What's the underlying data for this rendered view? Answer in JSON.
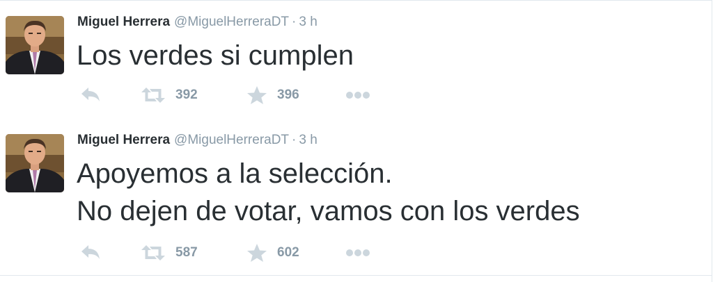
{
  "tweets": [
    {
      "fullname": "Miguel Herrera",
      "username": "@MiguelHerreraDT",
      "separator": "·",
      "time": "3 h",
      "text_lines": [
        "Los verdes si cumplen"
      ],
      "retweets": "392",
      "favorites": "396",
      "avatar_icon": "profile-photo-man-in-suit"
    },
    {
      "fullname": "Miguel Herrera",
      "username": "@MiguelHerreraDT",
      "separator": "·",
      "time": "3 h",
      "text_lines": [
        "Apoyemos a la selección.",
        "No dejen de votar, vamos con los verdes"
      ],
      "retweets": "587",
      "favorites": "602",
      "avatar_icon": "profile-photo-man-in-suit"
    }
  ],
  "icons": {
    "reply": "reply-icon",
    "retweet": "retweet-icon",
    "favorite": "star-icon",
    "more": "more-icon"
  },
  "colors": {
    "text": "#292f33",
    "muted": "#8899a6",
    "icon": "#ccd6dd",
    "border": "#e1e8ed"
  }
}
